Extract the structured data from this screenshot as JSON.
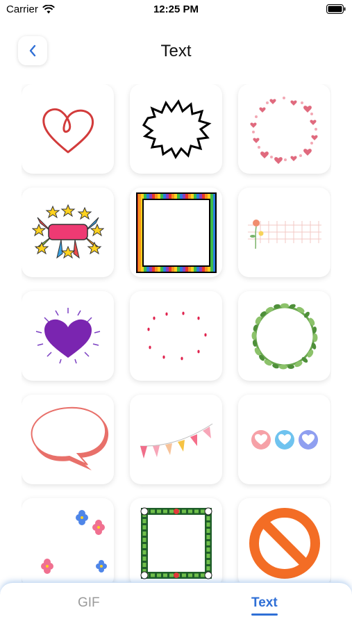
{
  "status_bar": {
    "carrier": "Carrier",
    "time": "12:25 PM"
  },
  "header": {
    "title": "Text"
  },
  "tiles": [
    {
      "name": "heart-outline-sticker"
    },
    {
      "name": "burst-frame-sticker"
    },
    {
      "name": "heart-ring-sticker"
    },
    {
      "name": "stars-banner-sticker"
    },
    {
      "name": "rainbow-frame-sticker"
    },
    {
      "name": "flower-grid-sticker"
    },
    {
      "name": "purple-heart-sticker"
    },
    {
      "name": "dot-circle-sticker"
    },
    {
      "name": "leaf-wreath-sticker"
    },
    {
      "name": "speech-bubble-sticker"
    },
    {
      "name": "bunting-sticker"
    },
    {
      "name": "heart-bubbles-sticker"
    },
    {
      "name": "flowers-corner-sticker"
    },
    {
      "name": "floral-frame-sticker"
    },
    {
      "name": "prohibition-sticker"
    }
  ],
  "tab_bar": {
    "gif_label": "GIF",
    "text_label": "Text",
    "active": "Text"
  }
}
